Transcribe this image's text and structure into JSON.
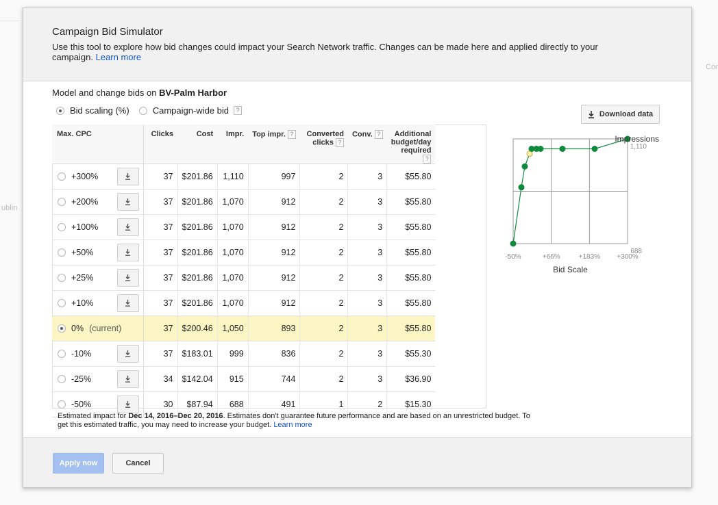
{
  "background": {
    "side_text_left": "ublin",
    "side_text_right": "Cor"
  },
  "dialog": {
    "title": "Campaign Bid Simulator",
    "description": "Use this tool to explore how bid changes could impact your Search Network traffic. Changes can be made here and applied directly to your campaign.",
    "learn_more": "Learn more",
    "model_prefix": "Model and change bids on",
    "campaign_name": "BV-Palm Harbor",
    "modes": [
      {
        "label": "Bid scaling (%)",
        "selected": true
      },
      {
        "label": "Campaign-wide bid",
        "selected": false
      }
    ],
    "download_label": "Download data",
    "help_mark": "?"
  },
  "table": {
    "headers": {
      "max_cpc": "Max. CPC",
      "clicks": "Clicks",
      "cost": "Cost",
      "impr": "Impr.",
      "top_impr": "Top impr.",
      "converted_clicks": "Converted clicks",
      "conv": "Conv.",
      "additional_budget": "Additional budget/day required"
    },
    "rows": [
      {
        "label": "+300%",
        "clicks": "37",
        "cost": "$201.86",
        "impr": "1,110",
        "top_impr": "997",
        "converted": "2",
        "conv": "3",
        "budget": "$55.80",
        "current": false
      },
      {
        "label": "+200%",
        "clicks": "37",
        "cost": "$201.86",
        "impr": "1,070",
        "top_impr": "912",
        "converted": "2",
        "conv": "3",
        "budget": "$55.80",
        "current": false
      },
      {
        "label": "+100%",
        "clicks": "37",
        "cost": "$201.86",
        "impr": "1,070",
        "top_impr": "912",
        "converted": "2",
        "conv": "3",
        "budget": "$55.80",
        "current": false
      },
      {
        "label": "+50%",
        "clicks": "37",
        "cost": "$201.86",
        "impr": "1,070",
        "top_impr": "912",
        "converted": "2",
        "conv": "3",
        "budget": "$55.80",
        "current": false
      },
      {
        "label": "+25%",
        "clicks": "37",
        "cost": "$201.86",
        "impr": "1,070",
        "top_impr": "912",
        "converted": "2",
        "conv": "3",
        "budget": "$55.80",
        "current": false
      },
      {
        "label": "+10%",
        "clicks": "37",
        "cost": "$201.86",
        "impr": "1,070",
        "top_impr": "912",
        "converted": "2",
        "conv": "3",
        "budget": "$55.80",
        "current": false
      },
      {
        "label": "0%",
        "label_suffix": "(current)",
        "clicks": "37",
        "cost": "$200.46",
        "impr": "1,050",
        "top_impr": "893",
        "converted": "2",
        "conv": "3",
        "budget": "$55.80",
        "current": true
      },
      {
        "label": "-10%",
        "clicks": "37",
        "cost": "$183.01",
        "impr": "999",
        "top_impr": "836",
        "converted": "2",
        "conv": "3",
        "budget": "$55.30",
        "current": false
      },
      {
        "label": "-25%",
        "clicks": "34",
        "cost": "$142.04",
        "impr": "915",
        "top_impr": "744",
        "converted": "2",
        "conv": "3",
        "budget": "$36.90",
        "current": false
      },
      {
        "label": "-50%",
        "clicks": "30",
        "cost": "$87.94",
        "impr": "688",
        "top_impr": "491",
        "converted": "1",
        "conv": "2",
        "budget": "$15.30",
        "current": false
      }
    ]
  },
  "footnote": {
    "prefix": "Estimated impact for",
    "date_range": "Dec 14, 2016–Dec 20, 2016",
    "suffix": ". Estimates don't guarantee future performance and are based on an unrestricted budget. To get this estimated traffic, you may need to increase your budget.",
    "learn_more": "Learn more"
  },
  "buttons": {
    "apply": "Apply now",
    "cancel": "Cancel"
  },
  "colors": {
    "series": "#0f8a3c",
    "current_point": "#fcf0a8",
    "current_row": "#fcf5c4",
    "apply_button": "#a3c0ef",
    "link": "#1155cc"
  },
  "chart_data": {
    "type": "line",
    "ylabel": "Impressions",
    "xlabel": "Bid Scale",
    "x_tick_labels": [
      "-50%",
      "+66%",
      "+183%",
      "+300%"
    ],
    "y_tick_labels": [
      "1,110",
      "688"
    ],
    "ylim": [
      688,
      1110
    ],
    "xlim": [
      -50,
      300
    ],
    "grid": true,
    "points": [
      {
        "x": -50,
        "y": 688
      },
      {
        "x": -25,
        "y": 915
      },
      {
        "x": -10,
        "y": 999
      },
      {
        "x": 0,
        "y": 1050,
        "current": true
      },
      {
        "x": 10,
        "y": 1070
      },
      {
        "x": 25,
        "y": 1070
      },
      {
        "x": 50,
        "y": 1070
      },
      {
        "x": 100,
        "y": 1070
      },
      {
        "x": 200,
        "y": 1070
      },
      {
        "x": 300,
        "y": 1110
      }
    ]
  }
}
